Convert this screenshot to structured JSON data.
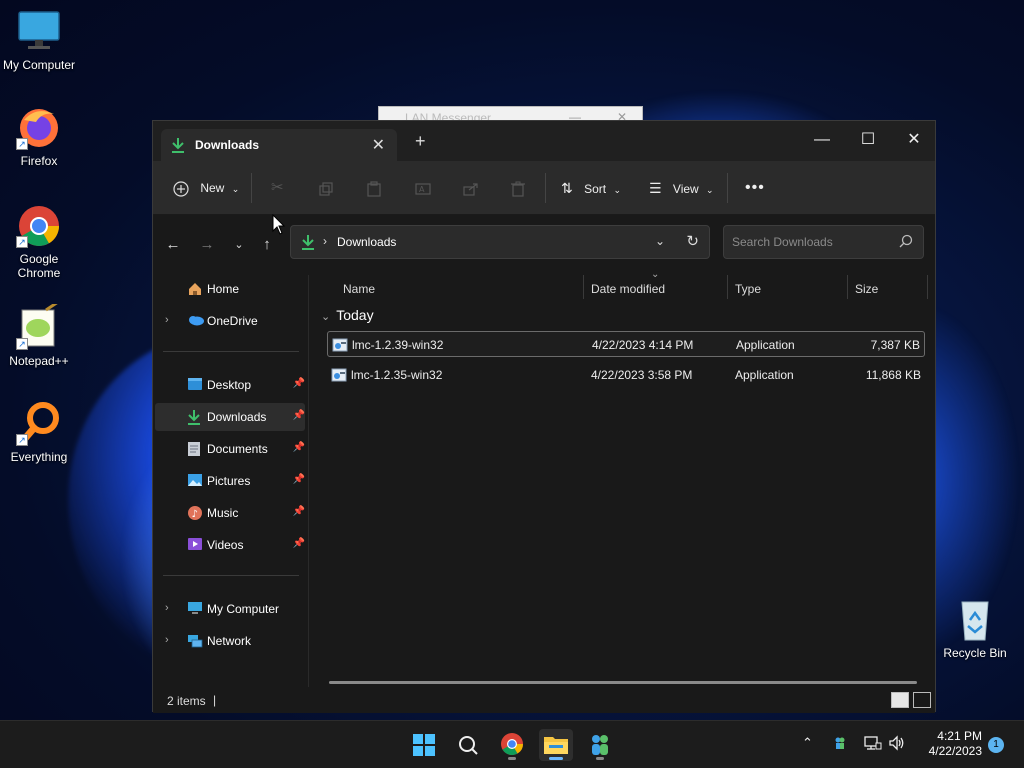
{
  "desktop": {
    "icons": [
      {
        "label": "My Computer"
      },
      {
        "label": "Firefox"
      },
      {
        "label": "Google Chrome"
      },
      {
        "label": "Notepad++"
      },
      {
        "label": "Everything"
      },
      {
        "label": "Recycle Bin"
      }
    ]
  },
  "background_window": {
    "title": "LAN Messenger"
  },
  "explorer": {
    "tab_title": "Downloads",
    "toolbar": {
      "new_label": "New",
      "sort_label": "Sort",
      "view_label": "View"
    },
    "address": {
      "path": "Downloads"
    },
    "search": {
      "placeholder": "Search Downloads"
    },
    "sidebar": {
      "items": [
        {
          "label": "Home"
        },
        {
          "label": "OneDrive"
        },
        {
          "label": "Desktop"
        },
        {
          "label": "Downloads"
        },
        {
          "label": "Documents"
        },
        {
          "label": "Pictures"
        },
        {
          "label": "Music"
        },
        {
          "label": "Videos"
        },
        {
          "label": "My Computer"
        },
        {
          "label": "Network"
        }
      ]
    },
    "columns": {
      "name": "Name",
      "date": "Date modified",
      "type": "Type",
      "size": "Size"
    },
    "group_label": "Today",
    "files": [
      {
        "name": "lmc-1.2.39-win32",
        "date": "4/22/2023 4:14 PM",
        "type": "Application",
        "size": "7,387 KB"
      },
      {
        "name": "lmc-1.2.35-win32",
        "date": "4/22/2023 3:58 PM",
        "type": "Application",
        "size": "11,868 KB"
      }
    ],
    "status": {
      "item_count": "2 items"
    }
  },
  "taskbar": {
    "clock_time": "4:21 PM",
    "clock_date": "4/22/2023",
    "notification_count": "1"
  },
  "colors": {
    "accent": "#4cc2ff",
    "downloads_green": "#3fbf6b",
    "folder_yellow": "#f5c542"
  }
}
